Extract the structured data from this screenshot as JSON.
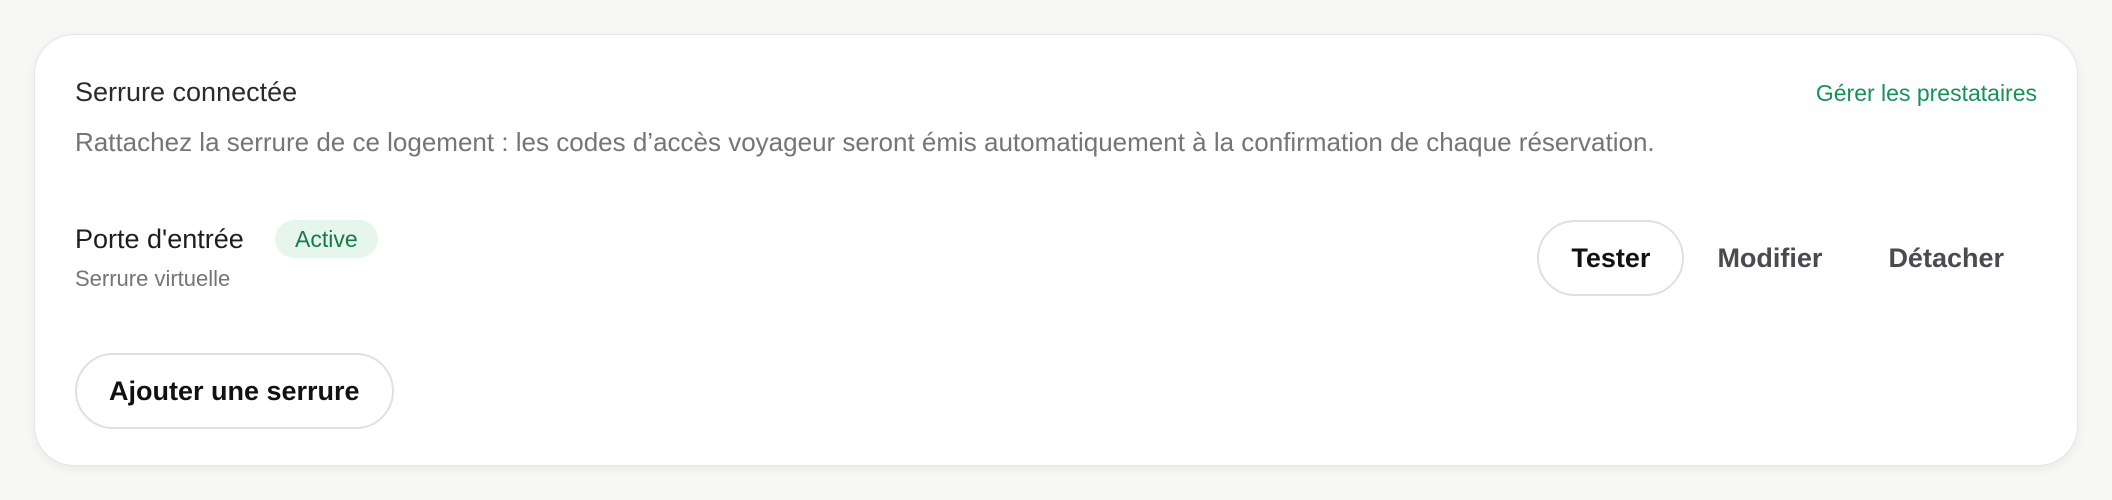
{
  "section": {
    "title": "Serrure connectée",
    "manage_link": "Gérer les prestataires",
    "description": "Rattachez la serrure de ce logement : les codes d’accès voyageur seront émis automatiquement à la confirmation de chaque réservation."
  },
  "lock": {
    "name": "Porte d'entrée",
    "status": "Active",
    "type": "Serrure virtuelle",
    "actions": {
      "test": "Tester",
      "edit": "Modifier",
      "detach": "Détacher"
    }
  },
  "add_lock_label": "Ajouter une serrure",
  "colors": {
    "accent": "#16915a",
    "badge_bg": "#e6f6ec",
    "badge_text": "#167a49"
  }
}
